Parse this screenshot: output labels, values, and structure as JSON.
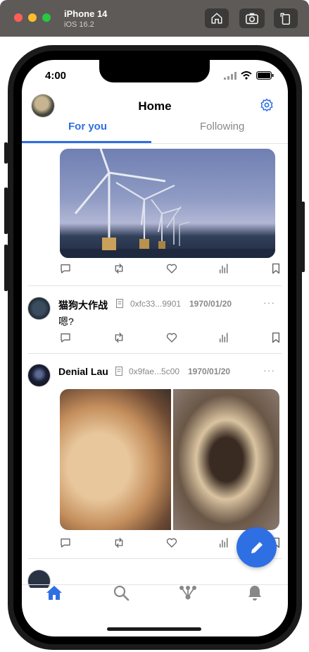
{
  "simulator": {
    "device_name": "iPhone 14",
    "os_version": "iOS 16.2",
    "buttons": [
      "home-icon",
      "screenshot-icon",
      "rotate-icon"
    ]
  },
  "status_bar": {
    "time": "4:00"
  },
  "header": {
    "title": "Home",
    "settings_icon": "gear-icon"
  },
  "tabs": [
    {
      "label": "For you",
      "active": true
    },
    {
      "label": "Following",
      "active": false
    }
  ],
  "posts": [
    {
      "id": "post-1",
      "media": "wind-turbines-photo",
      "actions": [
        "comment-icon",
        "repost-icon",
        "like-icon",
        "stats-icon",
        "bookmark-icon"
      ]
    },
    {
      "id": "post-2",
      "author": "猫狗大作战",
      "address": "0xfc33...9901",
      "date": "1970/01/20",
      "more": "···",
      "text": "嗯?",
      "actions": [
        "comment-icon",
        "repost-icon",
        "like-icon",
        "stats-icon",
        "bookmark-icon"
      ]
    },
    {
      "id": "post-3",
      "author": "Denial Lau",
      "address": "0x9fae...5c00",
      "date": "1970/01/20",
      "more": "···",
      "media": [
        "puppy-window-photo",
        "dogs-hugging-photo"
      ],
      "actions": [
        "comment-icon",
        "repost-icon",
        "like-icon",
        "stats-icon",
        "bookmark-icon"
      ]
    }
  ],
  "fab": {
    "icon": "compose-icon"
  },
  "bottom_nav": [
    {
      "name": "home",
      "icon": "home-icon",
      "active": true
    },
    {
      "name": "search",
      "icon": "search-icon",
      "active": false
    },
    {
      "name": "network",
      "icon": "network-icon",
      "active": false
    },
    {
      "name": "notifications",
      "icon": "bell-icon",
      "active": false
    }
  ],
  "colors": {
    "accent": "#2f6fe4",
    "inactive_icon": "#888888",
    "text_muted": "#888888"
  }
}
